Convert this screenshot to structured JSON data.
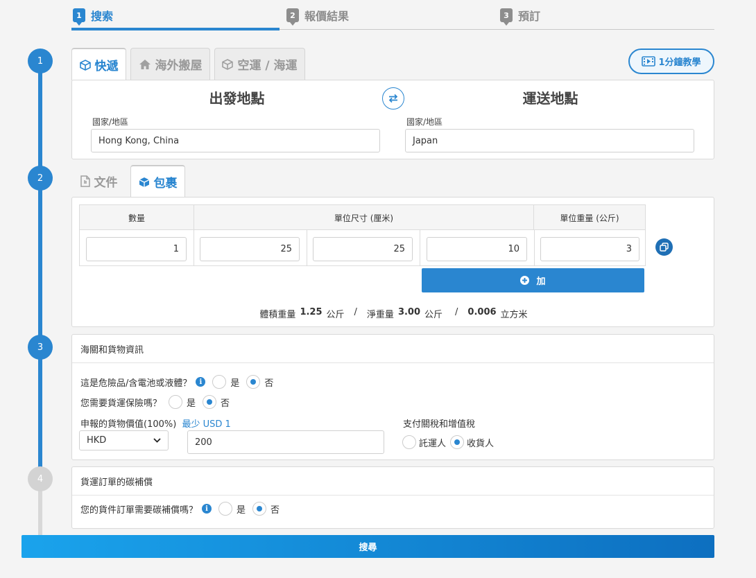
{
  "steps": [
    {
      "num": "1",
      "label": "搜索"
    },
    {
      "num": "2",
      "label": "報價結果"
    },
    {
      "num": "3",
      "label": "預訂"
    }
  ],
  "timeline": [
    "1",
    "2",
    "3",
    "4"
  ],
  "shipping_tabs": [
    {
      "label": "快遞",
      "icon": "box-icon"
    },
    {
      "label": "海外搬屋",
      "icon": "home-icon"
    },
    {
      "label": "空運 / 海運",
      "icon": "box-icon"
    }
  ],
  "tutorial_button": "1分鐘教學",
  "route": {
    "origin_title": "出發地點",
    "dest_title": "運送地點",
    "origin_label": "國家/地區",
    "origin_value": "Hong Kong, China",
    "dest_label": "國家/地區",
    "dest_value": "Japan"
  },
  "cargo_tabs": [
    {
      "label": "文件",
      "icon": "document-icon"
    },
    {
      "label": "包裹",
      "icon": "package-icon"
    }
  ],
  "package": {
    "col_quantity": "數量",
    "col_dimensions": "單位尺寸 (厘米)",
    "col_weight": "單位重量 (公斤)",
    "quantity": "1",
    "length": "25",
    "width": "25",
    "height": "10",
    "weight": "3",
    "add_button": "加",
    "summary_vol_label": "體積重量",
    "summary_vol_value": "1.25",
    "summary_vol_unit": "公斤",
    "summary_net_label": "淨重量",
    "summary_net_value": "3.00",
    "summary_net_unit": "公斤",
    "summary_cbm_value": "0.006",
    "summary_cbm_unit": "立方米",
    "sep": "/"
  },
  "customs": {
    "title": "海關和貨物資訊",
    "dangerous_q": "這是危險品/含電池或液體？",
    "insurance_q": "您需要貨運保險嗎？",
    "yes": "是",
    "no": "否",
    "declared_label": "申報的貨物價值(100%)",
    "min_note": "最少 USD 1",
    "currency": "HKD",
    "declared_value": "200",
    "duty_label": "支付關稅和增值稅",
    "duty_shipper": "託運人",
    "duty_consignee": "收貨人"
  },
  "carbon": {
    "title": "貨運訂單的碳補償",
    "question": "您的貨件訂單需要碳補償嗎？",
    "yes": "是",
    "no": "否"
  },
  "search_button": "搜尋",
  "colors": {
    "accent": "#2a86d0",
    "search_gradient_start": "#1aa3ec",
    "search_gradient_end": "#0d6fc0",
    "inactive": "#cfcfcf"
  }
}
